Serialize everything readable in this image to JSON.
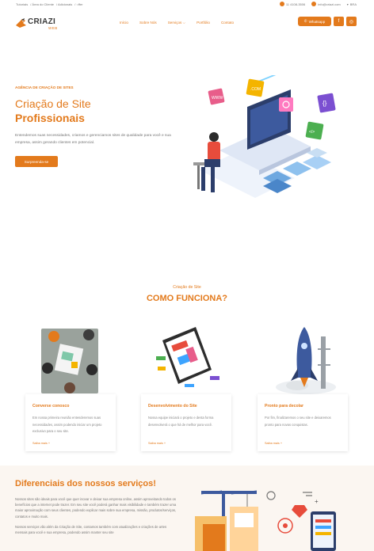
{
  "topbar": {
    "links": [
      "Tutoriais",
      "/ Área do Cliente",
      "/ Adicionais",
      "/ ○ffer"
    ],
    "phone": "11 4108-3506",
    "email": "info@criazi.com",
    "language": "BRA"
  },
  "brand": {
    "name": "CRIAZI",
    "sub": "WEB"
  },
  "nav": {
    "items": [
      "Início",
      "Sobre Nós",
      "Serviços ⌵",
      "Portfólio",
      "Contato"
    ]
  },
  "header": {
    "whatsapp_label": "Whatsapp",
    "facebook_glyph": "f",
    "instagram_glyph": "◎"
  },
  "hero": {
    "eyebrow": "AGÊNCIA DE CRIAÇÃO DE SITES",
    "title_line1": "Criação de Site",
    "title_line2": "Profissionais",
    "text": "Entendemos suas necessidades, criamos e gerenciamos sites de qualidade para você e sua empresa, assim gerando clientes em potencial.",
    "button": "Surpreenda-se"
  },
  "how": {
    "eyebrow": "Criação de Site",
    "title": "COMO FUNCIONA?",
    "steps": [
      {
        "title": "Converse conosco",
        "text": "Em nossa primeira reunião entenderemos suas necessidades, assim podendo iniciar um projeto exclusivo para o seu site.",
        "more": "Saiba mais +"
      },
      {
        "title": "Desenvolvimento do Site",
        "text": "Nossa equipe iniciará o projeto e desta forma desenvolverá o que há de melhor para você.",
        "more": "Saiba mais +"
      },
      {
        "title": "Pronto para decolar",
        "text": "Por fim, finalizaremos o seu site e deixaremos pronto para novas conquistas.",
        "more": "Saiba mais +"
      }
    ]
  },
  "diff": {
    "title": "Diferenciais dos nossos serviços!",
    "p1": "Nossos sites são ideais para você que quer inovar e deixar sua empresa online, assim aproveitando todos os benefícios que a internet pode trazer. Em seu site você poderá ganhar mais visibilidade e também trazer uma maior aproximação com seus clientes, podendo explicar mais sobre sua empresa, missão, produtos/serviços, contatos e muito mais.",
    "p2": "Nossos serviços vão além da Criação de Site, contamos também com atualizações e criações de artes mensais para você e sua empresa, podendo assim manter seu site"
  },
  "colors": {
    "accent": "#e37a1c",
    "text": "#777777",
    "diff_bg": "#fbf6f1"
  }
}
